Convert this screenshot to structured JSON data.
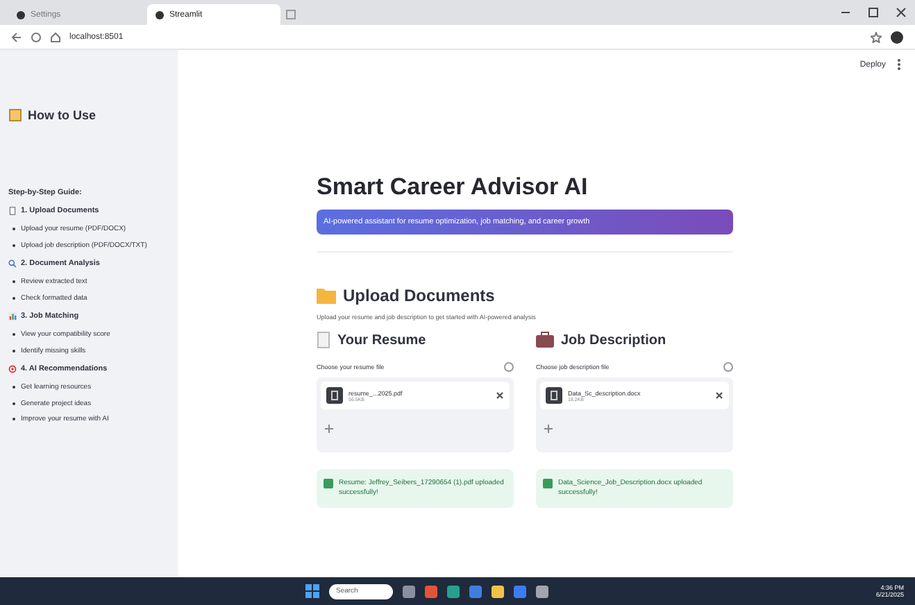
{
  "browser": {
    "tabs": [
      {
        "label": "Settings",
        "selected": false
      },
      {
        "label": "Streamlit",
        "selected": true
      }
    ],
    "url": "localhost:8501"
  },
  "app_menu": {
    "deploy": "Deploy"
  },
  "sidebar": {
    "title": "How to Use",
    "subtitle": "Step-by-Step Guide:",
    "steps": [
      {
        "label": "1. Upload Documents",
        "items": [
          "Upload your resume (PDF/DOCX)",
          "Upload job description (PDF/DOCX/TXT)"
        ]
      },
      {
        "label": "2. Document Analysis",
        "items": [
          "Review extracted text",
          "Check formatted data"
        ]
      },
      {
        "label": "3. Job Matching",
        "items": [
          "View your compatibility score",
          "Identify missing skills"
        ]
      },
      {
        "label": "4. AI Recommendations",
        "items": [
          "Get learning resources",
          "Generate project ideas",
          "Improve your resume with AI"
        ]
      }
    ]
  },
  "main": {
    "title": "Smart Career Advisor AI",
    "banner": "AI-powered assistant for resume optimization, job matching, and career growth",
    "section_title": "Upload Documents",
    "section_text": "Upload your resume and job description to get started with AI-powered analysis",
    "columns": [
      {
        "title": "Your Resume",
        "uploader_label": "Choose your resume file",
        "file_name": "resume_...2025.pdf",
        "file_size": "56.5KB",
        "success": "Resume: Jeffrey_Seibers_17290654 (1).pdf uploaded successfully!"
      },
      {
        "title": "Job Description",
        "uploader_label": "Choose job description file",
        "file_name": "Data_Sc_description.docx",
        "file_size": "18.2KB",
        "success": "Data_Science_Job_Description.docx uploaded successfully!"
      }
    ]
  },
  "taskbar": {
    "search_placeholder": "Search",
    "time": "4:36 PM",
    "date": "6/21/2025"
  }
}
